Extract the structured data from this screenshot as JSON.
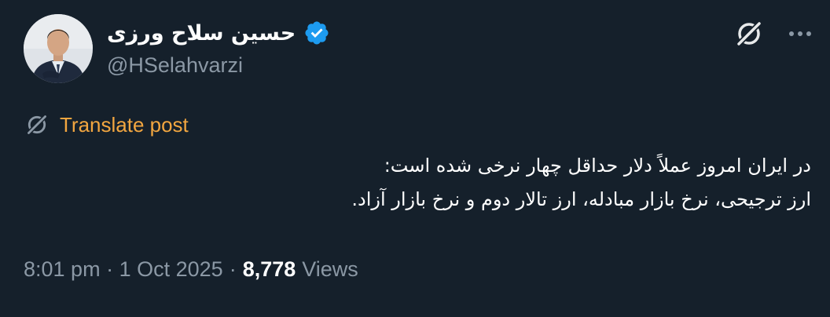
{
  "author": {
    "display_name": "حسین سلاح ورزی",
    "handle": "@HSelahvarzi",
    "verified": true,
    "verified_color": "#1d9bf0"
  },
  "actions": {
    "grok_icon": "grok-icon",
    "more_icon": "more-icon"
  },
  "translate": {
    "label": "Translate post",
    "icon": "grok-icon",
    "color": "#f2a640"
  },
  "post": {
    "lines": [
      "در ایران امروز عملاً دلار حداقل چهار نرخی شده است:",
      "ارز ترجیحی، نرخ بازار مبادله، ارز تالار دوم و نرخ بازار آزاد."
    ]
  },
  "meta": {
    "time": "8:01 pm",
    "separator": "·",
    "date": "1 Oct 2025",
    "views_count": "8,778",
    "views_label": "Views"
  },
  "colors": {
    "background": "#15202b",
    "text": "#ffffff",
    "secondary_text": "#8b98a5"
  }
}
